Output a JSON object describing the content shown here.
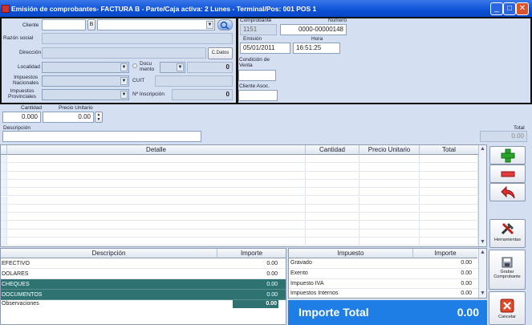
{
  "window": {
    "title": "Emisión de comprobantes- FACTURA B - Parte/Caja activa: 2 Lunes - Terminal/Pos: 001 POS 1",
    "min": "_",
    "max": "□",
    "close": "✕"
  },
  "cliente": {
    "label": "Cliente",
    "tipo": "B"
  },
  "labels": {
    "razon_social": "Razón social",
    "direccion": "Dirección",
    "localidad": "Localidad",
    "documento": "Docu\nmento",
    "impuestos_nacionales": "Impuestos\nNacionales",
    "cuit": "CUIT",
    "impuestos_provinciales": "Impuestos\nProvinciales",
    "nro_inscripcion": "Nº Inscripción"
  },
  "cdatos": "C.Datos",
  "documento_value": "0",
  "inscripcion_value": "0",
  "comprobante": {
    "label_comp": "Comprobante",
    "label_num": "Número",
    "comp": "1151",
    "numero": "0000-00000148",
    "label_emision": "Emisión",
    "label_hora": "Hora",
    "emision": "05/01/2011",
    "hora": "16:51:25",
    "label_condicion": "Condición de\nVenta",
    "label_cliente_asoc": "Cliente Asoc."
  },
  "entry": {
    "cantidad_label": "Cantidad",
    "precio_label": "Precio Unitario",
    "cantidad": "0.000",
    "precio": "0.00",
    "descripcion_label": "Descripción",
    "total_label": "Total",
    "total": "0.00"
  },
  "detalle": {
    "headers": [
      "Detalle",
      "Cantidad",
      "Precio Unitario",
      "Total"
    ]
  },
  "side_buttons": {
    "herramientas": "Herramientas",
    "grabar": "Grabar\nComprobante",
    "cancelar": "Cancelar"
  },
  "pagos": {
    "headers": [
      "Descripción",
      "Importe"
    ],
    "rows": [
      {
        "desc": "EFECTIVO",
        "imp": "0.00"
      },
      {
        "desc": "DOLARES",
        "imp": "0.00"
      },
      {
        "desc": "CHEQUES",
        "imp": "0.00"
      },
      {
        "desc": "DOCUMENTOS",
        "imp": "0.00"
      }
    ],
    "observaciones_label": "Observaciones",
    "observaciones_value": "0.00"
  },
  "impuestos": {
    "headers": [
      "Impuesto",
      "Importe"
    ],
    "rows": [
      {
        "desc": "Gravado",
        "imp": "0.00"
      },
      {
        "desc": "Exento",
        "imp": "0.00"
      },
      {
        "desc": "Impuesto IVA",
        "imp": "0.00"
      },
      {
        "desc": "Impuestos Internos",
        "imp": "0.00"
      }
    ]
  },
  "importe_total": {
    "label": "Importe Total",
    "value": "0.00"
  }
}
